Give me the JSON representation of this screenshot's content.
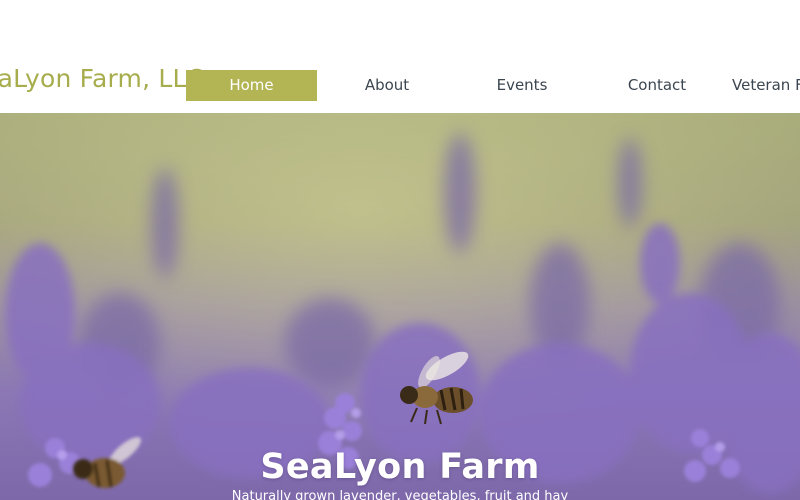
{
  "header": {
    "site_title": "SeaLyon Farm, LLC",
    "nav": [
      {
        "label": "Home",
        "active": true
      },
      {
        "label": "About",
        "active": false
      },
      {
        "label": "Events",
        "active": false
      },
      {
        "label": "Contact",
        "active": false
      },
      {
        "label": "Veteran Farmer",
        "active": false
      }
    ]
  },
  "hero": {
    "title": "SeaLyon Farm",
    "subtitle": "Naturally grown lavender, vegetables, fruit and hay",
    "image_subject": "lavender field with bees"
  },
  "colors": {
    "accent": "#b3b555",
    "title": "#a7ad4c",
    "nav_text": "#3c4650",
    "lavender": "#8e74c8"
  }
}
